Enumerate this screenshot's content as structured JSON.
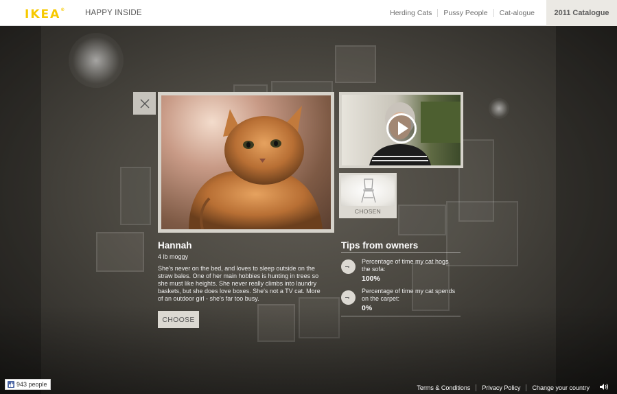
{
  "header": {
    "logo": "IKEA",
    "tagline": "HAPPY INSIDE",
    "nav": [
      "Herding Cats",
      "Pussy People",
      "Cat-alogue"
    ],
    "catalogue": "2011 Catalogue"
  },
  "profile": {
    "name": "Hannah",
    "meta": "4 lb moggy",
    "description": "She's never on the bed, and loves to sleep outside on the straw bales. One of her main hobbies is hunting in trees so she must like heights. She never really climbs into laundry baskets, but she does love boxes. She's not a TV cat. More of an outdoor girl - she's far too busy.",
    "choose_label": "CHOOSE",
    "chosen_label": "CHOSEN"
  },
  "tips": {
    "title": "Tips from owners",
    "items": [
      {
        "text": "Percentage of time my cat hogs the sofa:",
        "value": "100%"
      },
      {
        "text": "Percentage of time my cat spends on the carpet:",
        "value": "0%"
      }
    ]
  },
  "footer": {
    "like_count": "943 people",
    "links": [
      "Terms & Conditions",
      "Privacy Policy",
      "Change your country"
    ]
  },
  "icons": {
    "close": "close-icon",
    "play": "play-icon",
    "chair": "chair-icon",
    "like": "thumbs-up-icon",
    "sound": "speaker-icon"
  },
  "colors": {
    "brand_yellow": "#f7c900",
    "header_bg": "#ffffff",
    "catalogue_bg": "#ebe9e4",
    "button_bg": "#dcd9d2",
    "scene_bg": "#4b4841"
  }
}
